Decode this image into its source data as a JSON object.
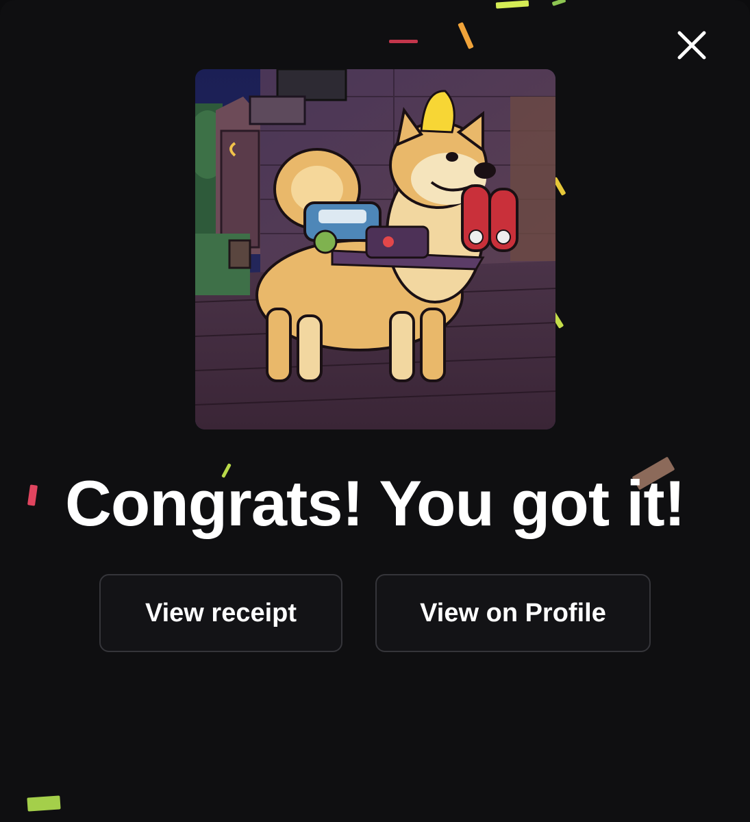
{
  "modal": {
    "title": "Congrats! You got it!",
    "close_icon": "close-icon",
    "nft_image": {
      "subject": "shiba-inu-dog-nft",
      "icon": "nft-artwork"
    },
    "actions": {
      "receipt_label": "View receipt",
      "profile_label": "View on Profile"
    }
  },
  "colors": {
    "background": "#0f0f11",
    "button_border": "#35353a",
    "button_bg": "#131316",
    "text": "#ffffff",
    "confetti": [
      "#c7e34f",
      "#f0a33a",
      "#e0455f",
      "#5b6bd6",
      "#b9d94a",
      "#8c6a5a"
    ]
  }
}
